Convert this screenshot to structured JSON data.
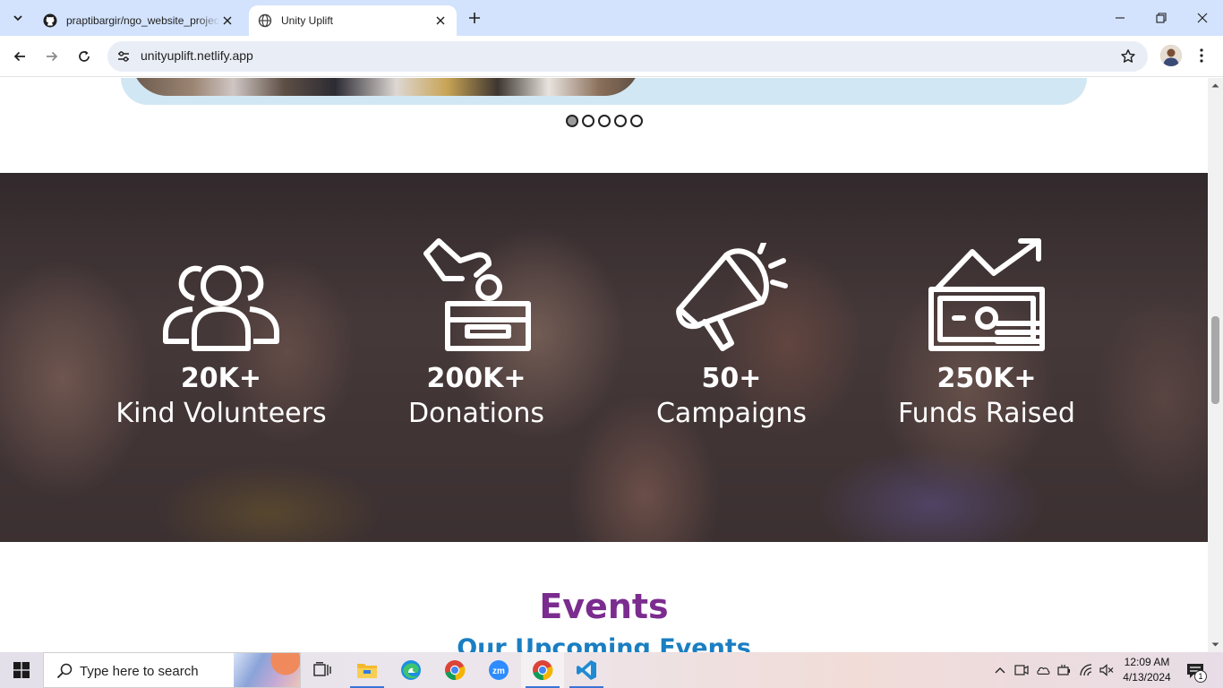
{
  "browser": {
    "tabs": [
      {
        "title": "praptibargir/ngo_website_project",
        "favicon": "github-icon",
        "active": false
      },
      {
        "title": "Unity Uplift",
        "favicon": "globe-icon",
        "active": true
      }
    ],
    "address": "unityuplift.netlify.app"
  },
  "page": {
    "carousel": {
      "dot_count": 5,
      "active_index": 0
    },
    "stats": [
      {
        "icon": "users-icon",
        "number": "20K+",
        "label": "Kind Volunteers"
      },
      {
        "icon": "donation-box-icon",
        "number": "200K+",
        "label": "Donations"
      },
      {
        "icon": "megaphone-icon",
        "number": "50+",
        "label": "Campaigns"
      },
      {
        "icon": "money-growth-icon",
        "number": "250K+",
        "label": "Funds Raised"
      }
    ],
    "events": {
      "title": "Events",
      "subtitle": "Our Upcoming Events"
    }
  },
  "taskbar": {
    "search_placeholder": "Type here to search",
    "apps": [
      "task-view-icon",
      "file-explorer-icon",
      "edge-icon",
      "chrome-icon",
      "zoom-icon",
      "chrome-icon",
      "vscode-icon"
    ],
    "time": "12:09 AM",
    "date": "4/13/2024",
    "notification_count": "1"
  },
  "colors": {
    "tab_strip": "#d3e3fd",
    "events_title": "#7b2c8f",
    "events_subtitle": "#1a7ec2",
    "carousel_card": "#d2e7f4"
  }
}
